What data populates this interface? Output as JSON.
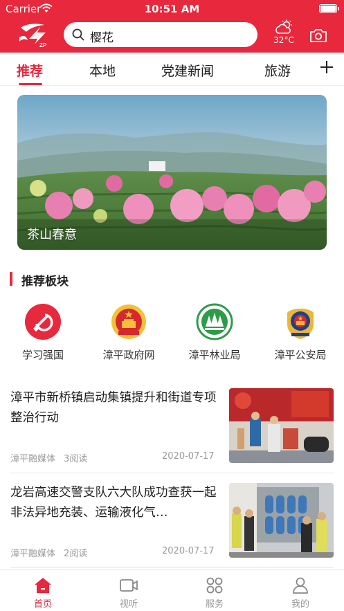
{
  "status_bar": {
    "carrier": "Carrier",
    "time": "10:51 AM"
  },
  "header": {
    "search_query": "樱花",
    "weather_temp": "32°C",
    "logo_text": "ZP"
  },
  "tabs": [
    {
      "label": "推荐",
      "active": true
    },
    {
      "label": "本地",
      "active": false
    },
    {
      "label": "党建新闻",
      "active": false
    },
    {
      "label": "旅游",
      "active": false
    }
  ],
  "banner": {
    "caption": "茶山春意"
  },
  "section": {
    "title": "推荐板块"
  },
  "quick_links": [
    {
      "label": "学习强国",
      "icon": "party-emblem-icon"
    },
    {
      "label": "漳平政府网",
      "icon": "national-emblem-icon"
    },
    {
      "label": "漳平林业局",
      "icon": "forestry-emblem-icon"
    },
    {
      "label": "漳平公安局",
      "icon": "police-emblem-icon"
    }
  ],
  "news": [
    {
      "title": "漳平市新桥镇启动集镇提升和街道专项整治行动",
      "source": "漳平融媒体",
      "reads": "3阅读",
      "date": "2020-07-17"
    },
    {
      "title": "龙岩高速交警支队六大队成功查获一起非法异地充装、运输液化气…",
      "source": "漳平融媒体",
      "reads": "2阅读",
      "date": "2020-07-17"
    }
  ],
  "bottom_nav": [
    {
      "label": "首页",
      "active": true
    },
    {
      "label": "视听",
      "active": false
    },
    {
      "label": "服务",
      "active": false
    },
    {
      "label": "我的",
      "active": false
    }
  ],
  "colors": {
    "brand_red": "#e8283c",
    "text": "#222222",
    "muted": "#999999"
  }
}
